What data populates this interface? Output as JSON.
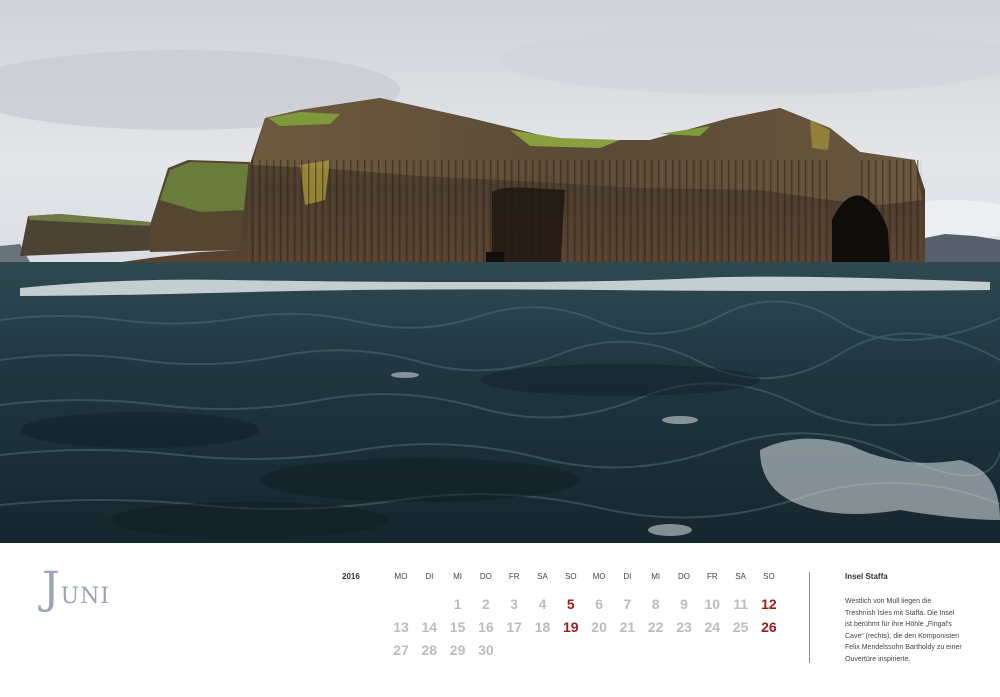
{
  "calendar": {
    "month": "Juni",
    "year": "2016",
    "weekdays": [
      "MO",
      "DI",
      "MI",
      "DO",
      "FR",
      "SA",
      "SO",
      "MO",
      "DI",
      "MI",
      "DO",
      "FR",
      "SA",
      "SO"
    ],
    "weeks": [
      [
        "",
        "",
        "1",
        "2",
        "3",
        "4",
        "5",
        "6",
        "7",
        "8",
        "9",
        "10",
        "11",
        "12"
      ],
      [
        "13",
        "14",
        "15",
        "16",
        "17",
        "18",
        "19",
        "20",
        "21",
        "22",
        "23",
        "24",
        "25",
        "26"
      ],
      [
        "27",
        "28",
        "29",
        "30",
        "",
        "",
        "",
        "",
        "",
        "",
        "",
        "",
        "",
        ""
      ]
    ],
    "sunday_color": "#a11c1c",
    "day_color": "#b9bcc2"
  },
  "info": {
    "title": "Insel Staffa",
    "text": "Westlich von Mull liegen die Treshnish Isles mit Staffa. Die Insel ist berühmt für ihre Höhle „Fingal's Cave“ (rechts), die den Komponisten Felix Mendelssohn Bartholdy zu einer Ouvertüre inspirierte."
  },
  "photo": {
    "subject": "basalt-column-island"
  }
}
